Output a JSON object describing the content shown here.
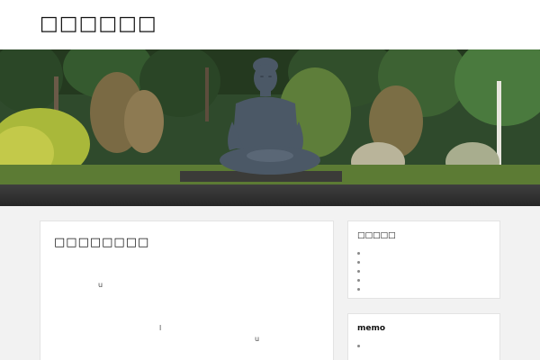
{
  "site": {
    "title": "□□□□□□"
  },
  "main": {
    "title": "□□□□□□□□",
    "fragments": [
      "u",
      "l",
      "u"
    ]
  },
  "sidebar": {
    "widget1": {
      "title": "□□□□□",
      "items": [
        "",
        "",
        "",
        "",
        ""
      ]
    },
    "widget2": {
      "title": "memo",
      "items": [
        ""
      ]
    }
  },
  "colors": {
    "header_bg": "#ffffff",
    "nav_bg": "#2e2e2e",
    "page_bg": "#f2f2f2",
    "card_bg": "#ffffff"
  }
}
